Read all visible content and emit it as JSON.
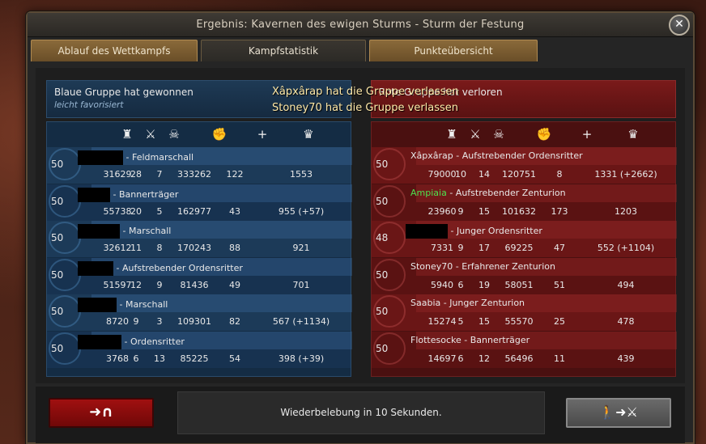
{
  "window": {
    "title": "Ergebnis: Kavernen des ewigen Sturms - Sturm der Festung"
  },
  "tabs": [
    "Ablauf des Wettkampfs",
    "Kampfstatistik",
    "Punkteübersicht"
  ],
  "blue_header": {
    "main": "Blaue Gruppe hat gewonnen",
    "sub": "leicht favorisiert"
  },
  "red_header": {
    "main": "Rote Gruppe hat verloren"
  },
  "notifications": [
    "Xâpxârap hat die Gruppe verlassen",
    "Stoney70 hat die Gruppe verlassen"
  ],
  "icons": [
    "tower-icon",
    "crossed-swords-icon",
    "skull-icon",
    "fist-icon",
    "plus-icon",
    "crown-icon"
  ],
  "blue_team": [
    {
      "level": "50",
      "name": "",
      "rank": "Feldmarschall",
      "stats": [
        "31629",
        "28",
        "7",
        "333262",
        "122",
        "1553"
      ]
    },
    {
      "level": "50",
      "name": "",
      "rank": "Bannerträger",
      "stats": [
        "55738",
        "20",
        "5",
        "162977",
        "43",
        "955 (+57)"
      ]
    },
    {
      "level": "50",
      "name": "",
      "rank": "Marschall",
      "stats": [
        "32612",
        "11",
        "8",
        "170243",
        "88",
        "921"
      ]
    },
    {
      "level": "50",
      "name": "",
      "rank": "Aufstrebender Ordensritter",
      "stats": [
        "51597",
        "12",
        "9",
        "81436",
        "49",
        "701"
      ]
    },
    {
      "level": "50",
      "name": "",
      "rank": "Marschall",
      "stats": [
        "8720",
        "9",
        "3",
        "109301",
        "82",
        "567 (+1134)"
      ]
    },
    {
      "level": "50",
      "name": "",
      "rank": "Ordensritter",
      "stats": [
        "3768",
        "6",
        "13",
        "85225",
        "54",
        "398 (+39)"
      ]
    }
  ],
  "red_team": [
    {
      "level": "50",
      "name": "Xâpxârap",
      "rank": "Aufstrebender Ordensritter",
      "stats": [
        "79000",
        "10",
        "14",
        "120751",
        "8",
        "1331 (+2662)"
      ]
    },
    {
      "level": "50",
      "name": "Ampiaia",
      "rank": "Aufstrebender Zenturion",
      "stats": [
        "23960",
        "9",
        "15",
        "101632",
        "173",
        "1203"
      ],
      "green": true
    },
    {
      "level": "48",
      "name": "",
      "rank": "Junger Ordensritter",
      "stats": [
        "7331",
        "9",
        "17",
        "69225",
        "47",
        "552 (+1104)"
      ]
    },
    {
      "level": "50",
      "name": "Stoney70",
      "rank": "Erfahrener Zenturion",
      "stats": [
        "5940",
        "6",
        "19",
        "58051",
        "51",
        "494"
      ]
    },
    {
      "level": "50",
      "name": "Saabia",
      "rank": "Junger Zenturion",
      "stats": [
        "15274",
        "5",
        "15",
        "55570",
        "25",
        "478"
      ]
    },
    {
      "level": "50",
      "name": "Flottesocke",
      "rank": "Bannerträger",
      "stats": [
        "14697",
        "6",
        "12",
        "56496",
        "11",
        "439"
      ]
    }
  ],
  "bottom": {
    "revive_text": "Wiederbelebung in 10 Sekunden."
  },
  "colors": {
    "blue_panel": "#142c44",
    "red_panel": "#4a1010",
    "exit_button": "#a01010",
    "swap_button": "#5a5a5a"
  }
}
